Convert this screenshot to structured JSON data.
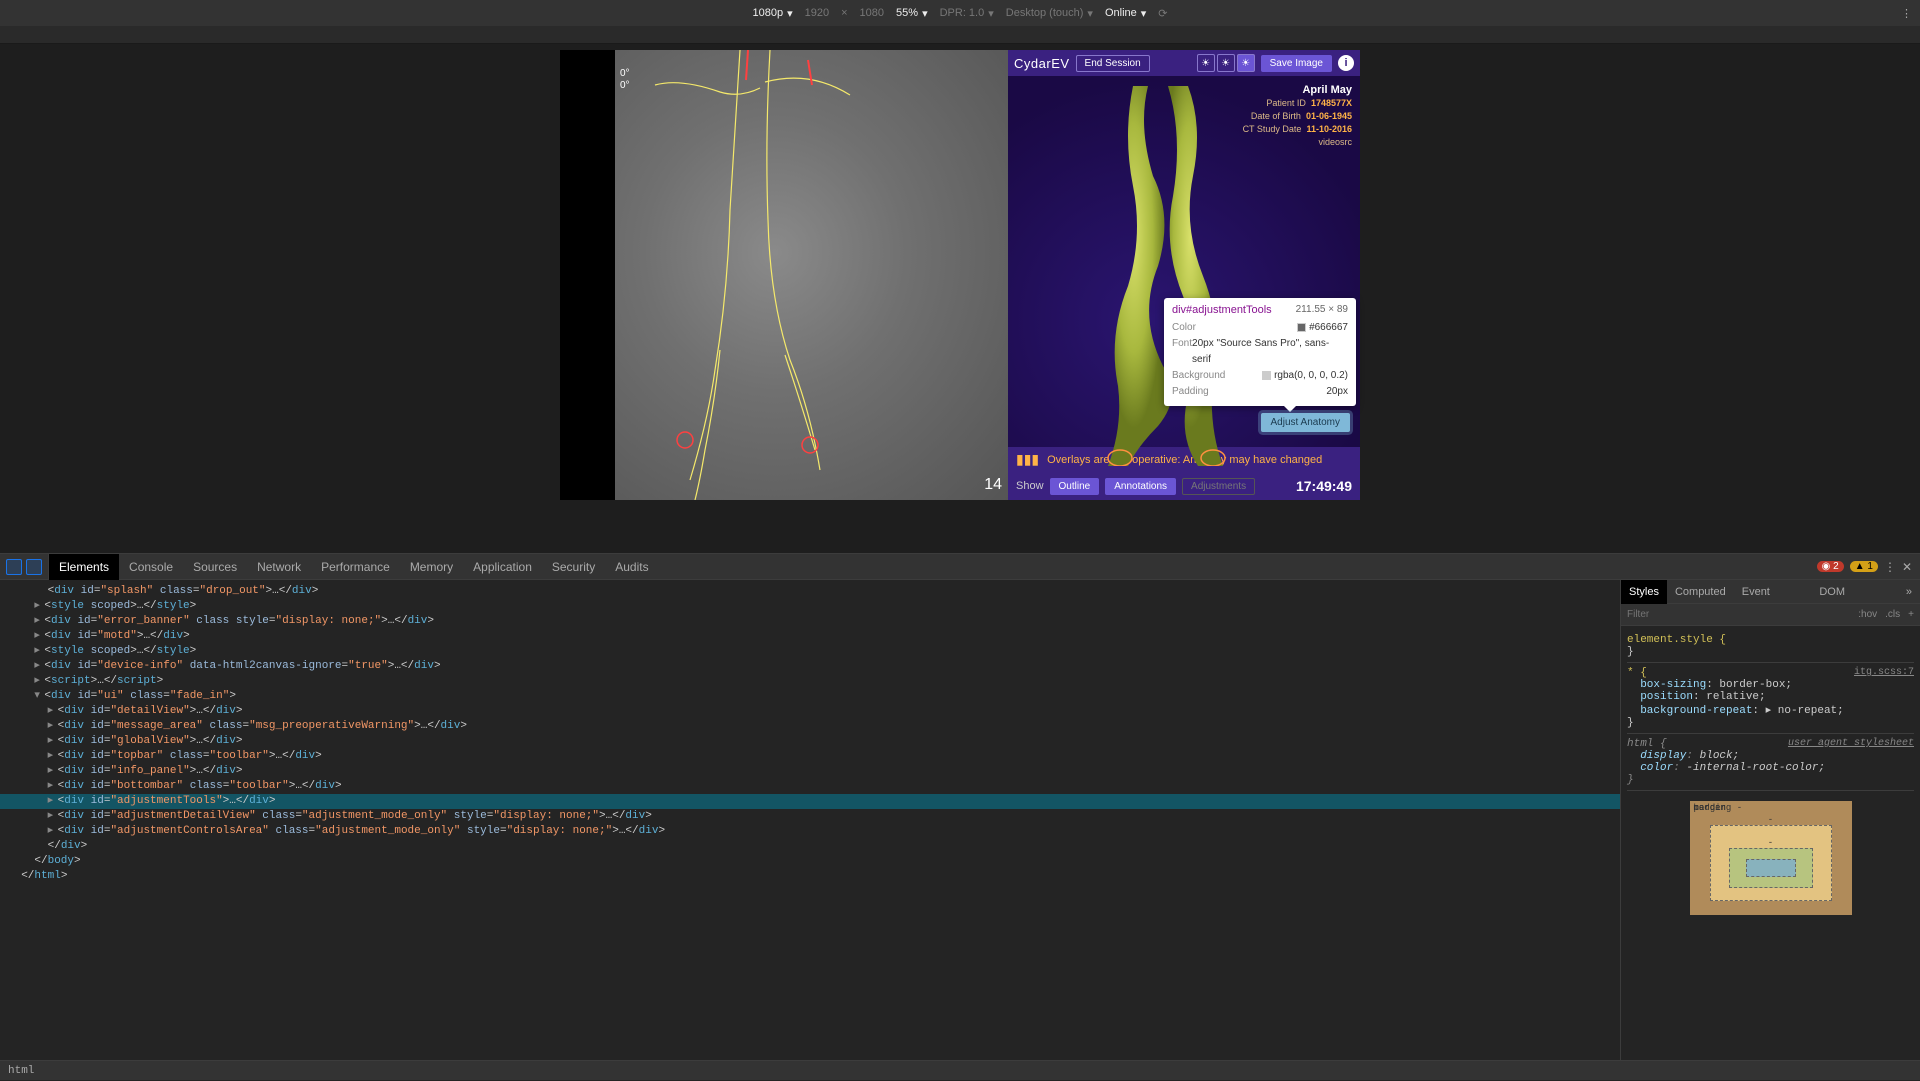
{
  "deviceBar": {
    "resolution": "1080p",
    "width": "1920",
    "height": "1080",
    "zoom": "55%",
    "dpr": "DPR: 1.0",
    "deviceType": "Desktop (touch)",
    "network": "Online"
  },
  "app": {
    "logoMain": "Cydar",
    "logoSuffix": "EV",
    "endSession": "End Session",
    "saveImage": "Save Image",
    "angles": {
      "top": "0°",
      "bottom": "0°"
    },
    "frameCount": "14",
    "patient": {
      "name": "April May",
      "idLabel": "Patient ID",
      "idValue": "1748577X",
      "dobLabel": "Date of Birth",
      "dobValue": "01-06-1945",
      "studyLabel": "CT Study Date",
      "studyValue": "11-10-2016",
      "source": "videosrc"
    },
    "adjustAnatomy": "Adjust Anatomy",
    "warning": "Overlays are pre-operative: Anatomy may have changed",
    "showLabel": "Show",
    "pills": {
      "outline": "Outline",
      "annotations": "Annotations",
      "adjustments": "Adjustments"
    },
    "clock": "17:49:49"
  },
  "tooltip": {
    "selector": "div#adjustmentTools",
    "dims": "211.55 × 89",
    "colorLabel": "Color",
    "color": "#666667",
    "fontLabel": "Font",
    "font": "20px \"Source Sans Pro\", sans-serif",
    "bgLabel": "Background",
    "bg": "rgba(0, 0, 0, 0.2)",
    "padLabel": "Padding",
    "pad": "20px"
  },
  "devtools": {
    "tabs": [
      "Elements",
      "Console",
      "Sources",
      "Network",
      "Performance",
      "Memory",
      "Application",
      "Security",
      "Audits"
    ],
    "errCount": "2",
    "warnCount": "1",
    "stylesTabs": [
      "Styles",
      "Computed",
      "Event Listeners",
      "DOM Breakpoints"
    ],
    "filterPlaceholder": "Filter",
    "hov": ":hov",
    "cls": ".cls",
    "breadcrumb": "html",
    "elementStyle": "element.style {",
    "starSel": "* {",
    "starSrc": "itg.scss:7",
    "r1p": "box-sizing",
    "r1v": "border-box;",
    "r2p": "position",
    "r2v": "relative;",
    "r3p": "background-repeat",
    "r3v": "▸ no-repeat;",
    "htmlSel": "html {",
    "htmlSrc": "user agent stylesheet",
    "r4p": "display",
    "r4v": "block;",
    "r5p": "color",
    "r5v": "-internal-root-color;",
    "bmMargin": "margin",
    "bmBorder": "border",
    "bmPadding": "padding -"
  }
}
